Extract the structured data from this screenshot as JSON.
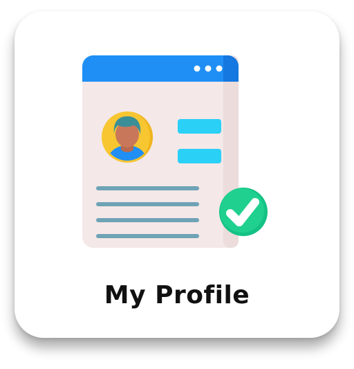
{
  "tile": {
    "label": "My Profile",
    "icon": "profile-document-verified-icon"
  },
  "colors": {
    "card_background": "#ffffff",
    "header_blue": "#1f8ff5",
    "paper": "#f4e8e8",
    "avatar_ring": "#f7c631",
    "field_cyan": "#2ad0f6",
    "text_lines": "#6fa3b6",
    "check_badge": "#1fd08f"
  }
}
